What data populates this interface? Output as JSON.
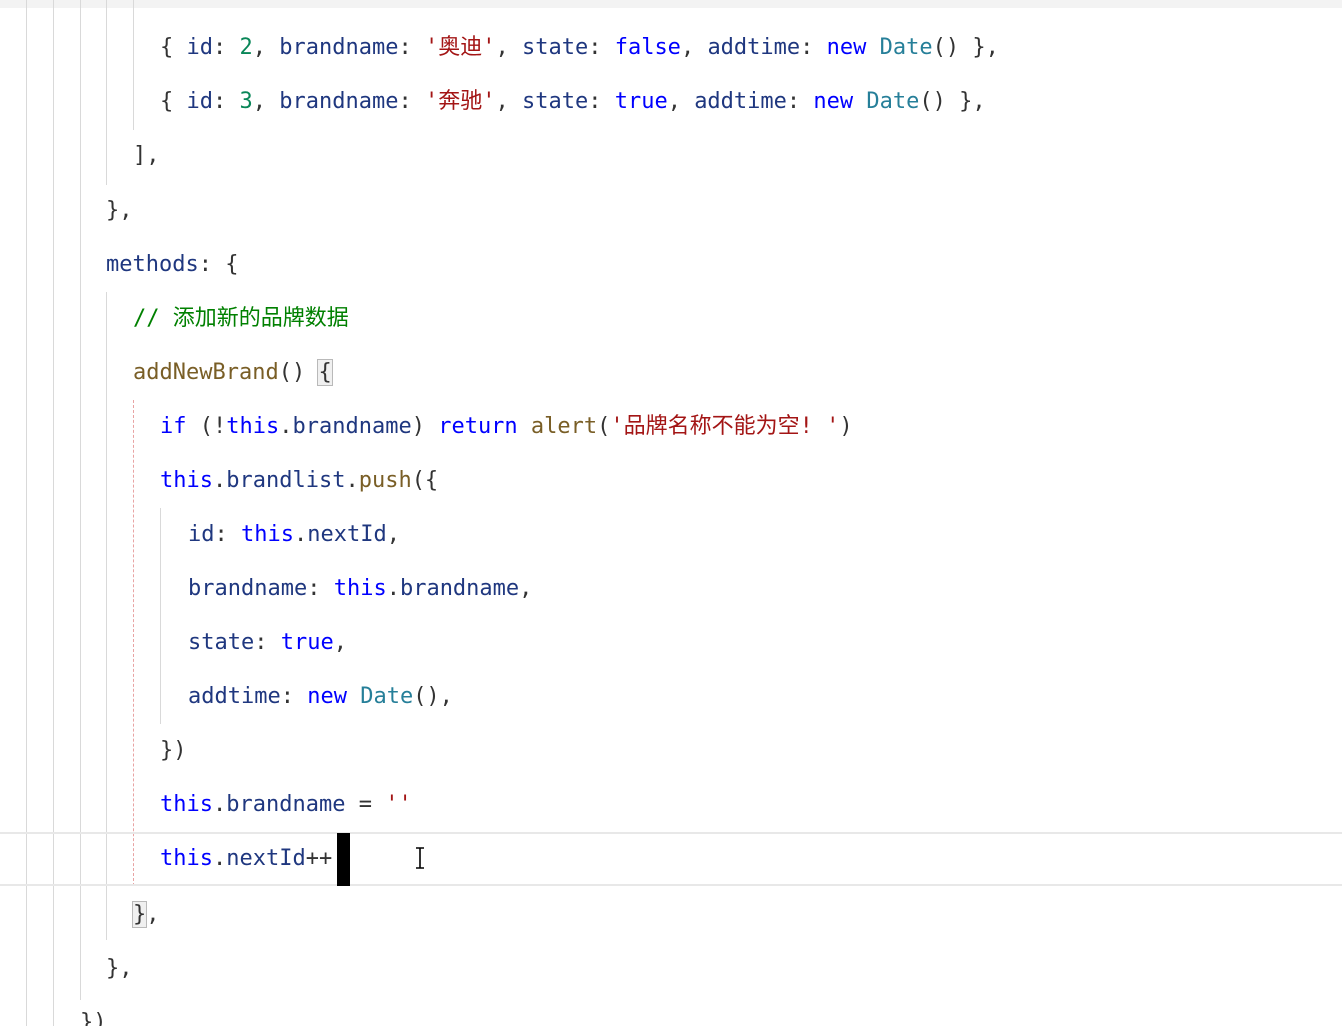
{
  "editor": {
    "lines": [
      {
        "tokens": [
          {
            "text": "{ ",
            "type": "p"
          },
          {
            "text": "id",
            "type": "pr"
          },
          {
            "text": ": ",
            "type": "p"
          },
          {
            "text": "2",
            "type": "n"
          },
          {
            "text": ", ",
            "type": "p"
          },
          {
            "text": "brandname",
            "type": "pr"
          },
          {
            "text": ": ",
            "type": "p"
          },
          {
            "text": "'奥迪'",
            "type": "s"
          },
          {
            "text": ", ",
            "type": "p"
          },
          {
            "text": "state",
            "type": "pr"
          },
          {
            "text": ": ",
            "type": "p"
          },
          {
            "text": "false",
            "type": "k"
          },
          {
            "text": ", ",
            "type": "p"
          },
          {
            "text": "addtime",
            "type": "pr"
          },
          {
            "text": ": ",
            "type": "p"
          },
          {
            "text": "new ",
            "type": "k"
          },
          {
            "text": "Date",
            "type": "t"
          },
          {
            "text": "() },",
            "type": "p"
          }
        ]
      },
      {
        "tokens": [
          {
            "text": "{ ",
            "type": "p"
          },
          {
            "text": "id",
            "type": "pr"
          },
          {
            "text": ": ",
            "type": "p"
          },
          {
            "text": "3",
            "type": "n"
          },
          {
            "text": ", ",
            "type": "p"
          },
          {
            "text": "brandname",
            "type": "pr"
          },
          {
            "text": ": ",
            "type": "p"
          },
          {
            "text": "'奔驰'",
            "type": "s"
          },
          {
            "text": ", ",
            "type": "p"
          },
          {
            "text": "state",
            "type": "pr"
          },
          {
            "text": ": ",
            "type": "p"
          },
          {
            "text": "true",
            "type": "k"
          },
          {
            "text": ", ",
            "type": "p"
          },
          {
            "text": "addtime",
            "type": "pr"
          },
          {
            "text": ": ",
            "type": "p"
          },
          {
            "text": "new ",
            "type": "k"
          },
          {
            "text": "Date",
            "type": "t"
          },
          {
            "text": "() },",
            "type": "p"
          }
        ]
      },
      {
        "tokens": [
          {
            "text": "],",
            "type": "p"
          }
        ]
      },
      {
        "tokens": [
          {
            "text": "},",
            "type": "p"
          }
        ]
      },
      {
        "tokens": [
          {
            "text": "methods",
            "type": "pr"
          },
          {
            "text": ": {",
            "type": "p"
          }
        ]
      },
      {
        "tokens": [
          {
            "text": "// 添加新的品牌数据",
            "type": "c"
          }
        ]
      },
      {
        "tokens": [
          {
            "text": "addNewBrand",
            "type": "fn"
          },
          {
            "text": "() ",
            "type": "p"
          },
          {
            "text": "{",
            "type": "p",
            "match": true
          }
        ]
      },
      {
        "tokens": [
          {
            "text": "if ",
            "type": "k"
          },
          {
            "text": "(!",
            "type": "p"
          },
          {
            "text": "this",
            "type": "k"
          },
          {
            "text": ".",
            "type": "p"
          },
          {
            "text": "brandname",
            "type": "pr"
          },
          {
            "text": ") ",
            "type": "p"
          },
          {
            "text": "return ",
            "type": "k"
          },
          {
            "text": "alert",
            "type": "fn"
          },
          {
            "text": "(",
            "type": "p"
          },
          {
            "text": "'品牌名称不能为空! '",
            "type": "s"
          },
          {
            "text": ")",
            "type": "p"
          }
        ]
      },
      {
        "tokens": [
          {
            "text": "this",
            "type": "k"
          },
          {
            "text": ".",
            "type": "p"
          },
          {
            "text": "brandlist",
            "type": "pr"
          },
          {
            "text": ".",
            "type": "p"
          },
          {
            "text": "push",
            "type": "fn"
          },
          {
            "text": "({",
            "type": "p"
          }
        ]
      },
      {
        "tokens": [
          {
            "text": "id",
            "type": "pr"
          },
          {
            "text": ": ",
            "type": "p"
          },
          {
            "text": "this",
            "type": "k"
          },
          {
            "text": ".",
            "type": "p"
          },
          {
            "text": "nextId",
            "type": "pr"
          },
          {
            "text": ",",
            "type": "p"
          }
        ]
      },
      {
        "tokens": [
          {
            "text": "brandname",
            "type": "pr"
          },
          {
            "text": ": ",
            "type": "p"
          },
          {
            "text": "this",
            "type": "k"
          },
          {
            "text": ".",
            "type": "p"
          },
          {
            "text": "brandname",
            "type": "pr"
          },
          {
            "text": ",",
            "type": "p"
          }
        ]
      },
      {
        "tokens": [
          {
            "text": "state",
            "type": "pr"
          },
          {
            "text": ": ",
            "type": "p"
          },
          {
            "text": "true",
            "type": "k"
          },
          {
            "text": ",",
            "type": "p"
          }
        ]
      },
      {
        "tokens": [
          {
            "text": "addtime",
            "type": "pr"
          },
          {
            "text": ": ",
            "type": "p"
          },
          {
            "text": "new ",
            "type": "k"
          },
          {
            "text": "Date",
            "type": "t"
          },
          {
            "text": "(),",
            "type": "p"
          }
        ]
      },
      {
        "tokens": [
          {
            "text": "})",
            "type": "p"
          }
        ]
      },
      {
        "tokens": [
          {
            "text": "this",
            "type": "k"
          },
          {
            "text": ".",
            "type": "p"
          },
          {
            "text": "brandname",
            "type": "pr"
          },
          {
            "text": " = ",
            "type": "p"
          },
          {
            "text": "''",
            "type": "s"
          }
        ]
      },
      {
        "tokens": [
          {
            "text": "this",
            "type": "k"
          },
          {
            "text": ".",
            "type": "p"
          },
          {
            "text": "nextId",
            "type": "pr"
          },
          {
            "text": "++",
            "type": "p"
          }
        ]
      },
      {
        "tokens": [
          {
            "text": "}",
            "type": "p",
            "match": true
          },
          {
            "text": ",",
            "type": "p"
          }
        ]
      },
      {
        "tokens": [
          {
            "text": "},",
            "type": "p"
          }
        ]
      },
      {
        "tokens": [
          {
            "text": "})",
            "type": "p"
          }
        ]
      }
    ]
  },
  "theme": {
    "keyword": "#0000ff",
    "property": "#1f377f",
    "function": "#795e26",
    "string": "#a31515",
    "number": "#098658",
    "comment": "#008000",
    "type": "#267f99",
    "current_line_border": "#e8e8e8"
  }
}
